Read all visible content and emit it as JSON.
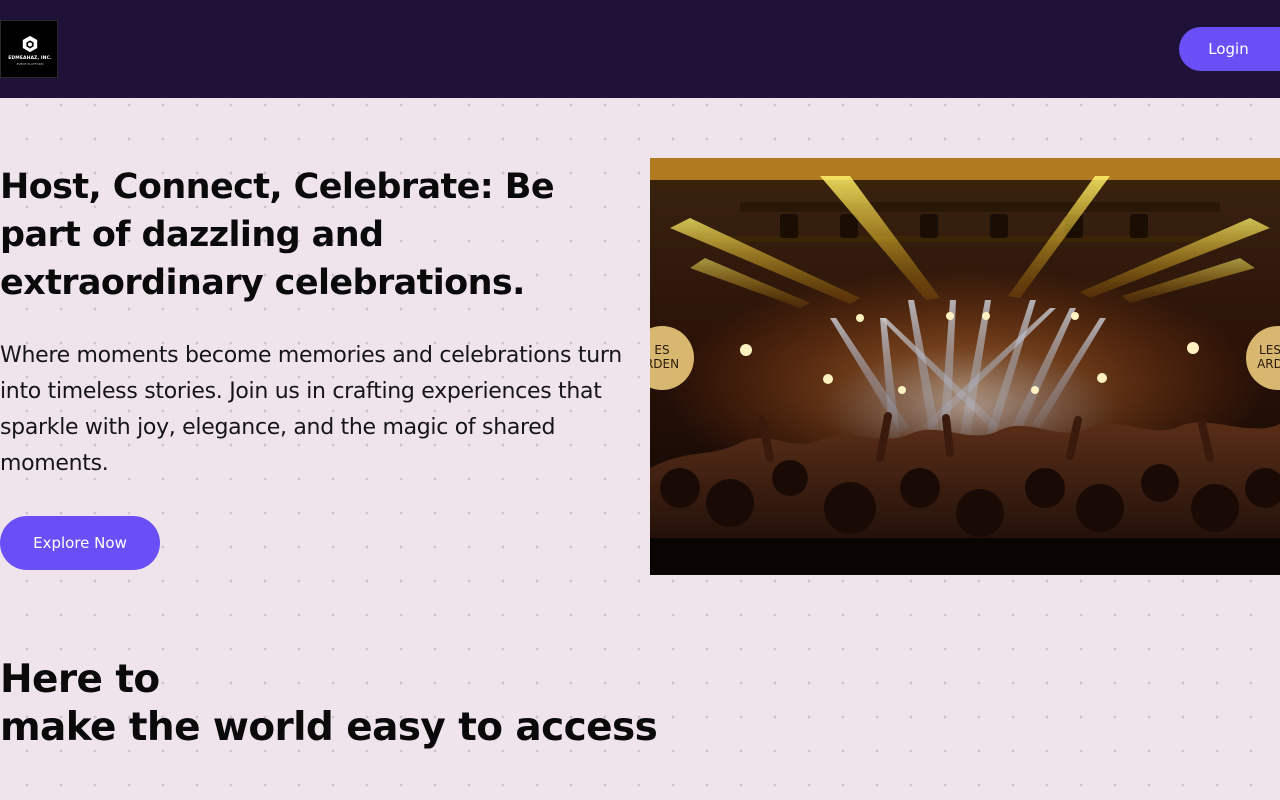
{
  "header": {
    "logo": {
      "icon": "hexagon-logo-icon",
      "name": "EDMEAHAZ, INC.",
      "tagline": "EVENT PLATFORM"
    },
    "login_label": "Login"
  },
  "hero": {
    "title": "Host, Connect, Celebrate: Be part of dazzling and extraordinary celebrations.",
    "description": "Where moments become memories and celebrations turn into timeless stories. Join us in crafting experiences that sparkle with joy, elegance, and the magic of shared moments.",
    "cta_label": "Explore Now",
    "image": {
      "subject": "concert-crowd-stage-lights",
      "sign_left": "LES JARDENTES",
      "sign_right": "LES JARDENTES"
    }
  },
  "section": {
    "title_line1": "Here to",
    "title_line2": "make the world easy to access"
  },
  "colors": {
    "nav_bg": "#1f1137",
    "page_bg": "#efe4ec",
    "accent": "#6b4ff6",
    "text": "#0a0a0a"
  }
}
